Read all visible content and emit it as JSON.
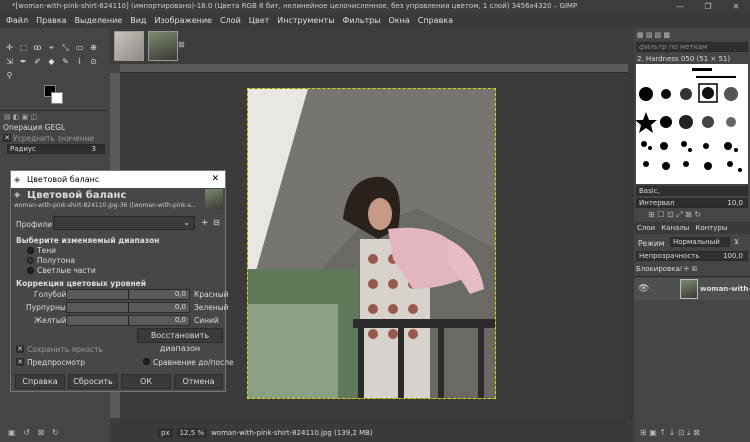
{
  "window": {
    "title": "*[woman-with-pink-shirt-824110] (импортировано)-18.0 (Цвета RGB 8 бит, нелинейное целочисленное, без управления цветом, 1 слой) 3456x4320 – GIMP",
    "minimize": "—",
    "maximize": "❐",
    "close": "✕"
  },
  "menu": [
    "Файл",
    "Правка",
    "Выделение",
    "Вид",
    "Изображение",
    "Слой",
    "Цвет",
    "Инструменты",
    "Фильтры",
    "Окна",
    "Справка"
  ],
  "tools": [
    "✛",
    "⬚",
    "ꝏ",
    "⌖",
    "⤡",
    "▭",
    "⊕",
    "⇲",
    "✒",
    "✐",
    "◆",
    "✎",
    "⌇",
    "⊙",
    "⚲"
  ],
  "gegl": {
    "title": "Операция GEGL",
    "average": "Усреднить значение",
    "radius_label": "Радиус",
    "radius_value": "3"
  },
  "dialog": {
    "title": "Цветовой баланс",
    "heading": "Цветовой баланс",
    "subtitle": "woman-with-pink-shirt-824110.jpg-36 ([woman-with-pink-s...",
    "profiles_label": "Профили:",
    "range_heading": "Выберите изменяемый диапазон",
    "ranges": [
      "Тени",
      "Полутона",
      "Светлые части"
    ],
    "selected_range": "Полутона",
    "levels_heading": "Коррекция цветовых уровней",
    "sliders": [
      {
        "left": "Голубой",
        "value": "0,0",
        "right": "Красный"
      },
      {
        "left": "Пурпурный",
        "value": "0,0",
        "right": "Зеленый"
      },
      {
        "left": "Желтый",
        "value": "0,0",
        "right": "Синий"
      }
    ],
    "reset_range": "Восстановить диапазон",
    "preserve": "Сохранить яркость",
    "preview": "Предпросмотр",
    "compare": "Сравнение до/после",
    "buttons": {
      "help": "Справка",
      "reset": "Сбросить",
      "ok": "ОК",
      "cancel": "Отмена"
    }
  },
  "status": {
    "unit": "px",
    "zoom": "12,5 %",
    "file": "woman-with-pink-shirt-824110.jpg (139,2 MB)"
  },
  "brushes": {
    "filter_placeholder": "фильтр по меткам",
    "current": "2. Hardness 050 (51 × 51)",
    "tag": "Basic,",
    "spacing_label": "Интервал",
    "spacing_value": "10,0"
  },
  "layers": {
    "tabs": [
      "Слои",
      "Каналы",
      "Контуры"
    ],
    "mode_label": "Режим",
    "mode_value": "Нормальный",
    "opacity_label": "Непрозрачность",
    "opacity_value": "100,0",
    "lock_label": "Блокировка:",
    "layer_name": "woman-with-pi"
  }
}
